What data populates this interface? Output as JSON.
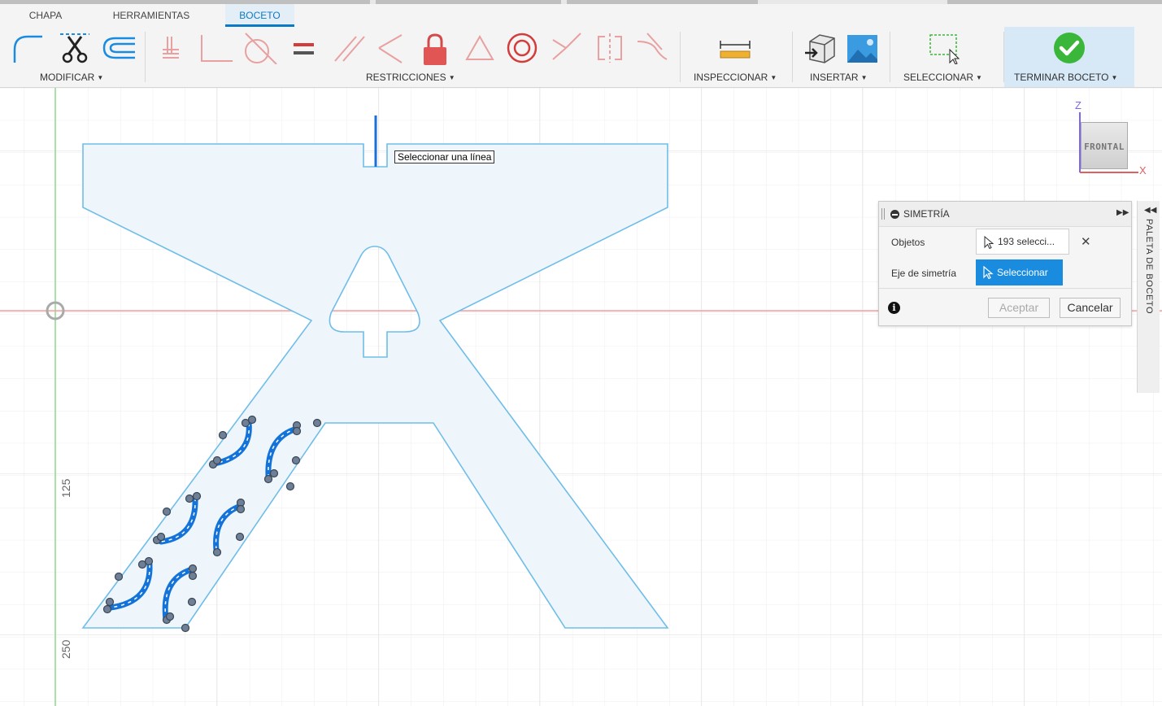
{
  "tabs": [
    {
      "label": "CHAPA"
    },
    {
      "label": "HERRAMIENTAS"
    },
    {
      "label": "BOCETO"
    }
  ],
  "toolbar": {
    "groups": {
      "modify": "MODIFICAR",
      "constraints": "RESTRICCIONES",
      "inspect": "INSPECCIONAR",
      "insert": "INSERTAR",
      "select": "SELECCIONAR",
      "finish": "TERMINAR BOCETO"
    },
    "icons": [
      "fillet-icon",
      "trim-icon",
      "offset-icon",
      "coincident-icon",
      "collinear-icon",
      "tangent-icon",
      "equal-icon",
      "parallel-icon",
      "perpendicular-icon",
      "fix-icon",
      "midpoint-icon",
      "concentric-icon",
      "horizontal-vertical-icon",
      "symmetry-icon",
      "curvature-icon",
      "measure-icon",
      "insert-component-icon",
      "insert-image-icon",
      "select-window-icon",
      "finish-sketch-icon"
    ]
  },
  "canvas": {
    "tooltip": "Seleccionar una línea",
    "ruler_labels": [
      "125",
      "250"
    ],
    "view_cube": {
      "face": "FRONTAL",
      "axis_z": "Z",
      "axis_x": "X"
    }
  },
  "dialog": {
    "title": "SIMETRÍA",
    "objects_label": "Objetos",
    "objects_value": "193 selecci...",
    "axis_label": "Eje de simetría",
    "axis_button": "Seleccionar",
    "accept": "Aceptar",
    "cancel": "Cancelar"
  },
  "palette": {
    "label": "PALETA DE BOCETO"
  },
  "colors": {
    "accent": "#0b79c6",
    "sketch_line": "#6fbde8",
    "sketch_fill": "#eef6fc",
    "selected": "#1373d8",
    "finish_green": "#3ab73a",
    "constraint_red": "#e05a5a",
    "axis_green": "#8fd98f",
    "axis_red": "#f2a0a0"
  }
}
